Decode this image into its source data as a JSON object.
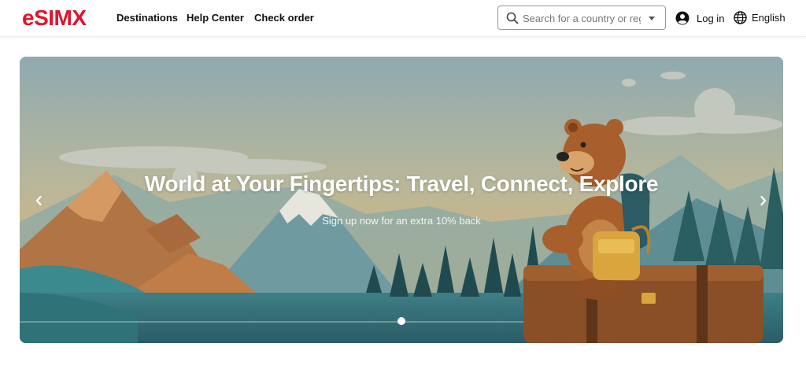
{
  "header": {
    "logo": "eSIMX",
    "nav": [
      {
        "label": "Destinations"
      },
      {
        "label": "Help Center"
      },
      {
        "label": "Check order"
      }
    ],
    "search": {
      "placeholder": "Search for a country or regi...",
      "value": ""
    },
    "login_label": "Log in",
    "language_label": "English"
  },
  "hero": {
    "title": "World at Your Fingertips: Travel, Connect, Explore",
    "subtitle": "Sign up now for an extra 10% back",
    "slides_count": 1,
    "active_slide": 1
  },
  "colors": {
    "brand": "#e0142b",
    "hero_sky": "#8faab0",
    "text": "#111111"
  },
  "icons": [
    "search-icon",
    "chevron-down-icon",
    "user-icon",
    "globe-icon",
    "chevron-left-icon",
    "chevron-right-icon"
  ]
}
